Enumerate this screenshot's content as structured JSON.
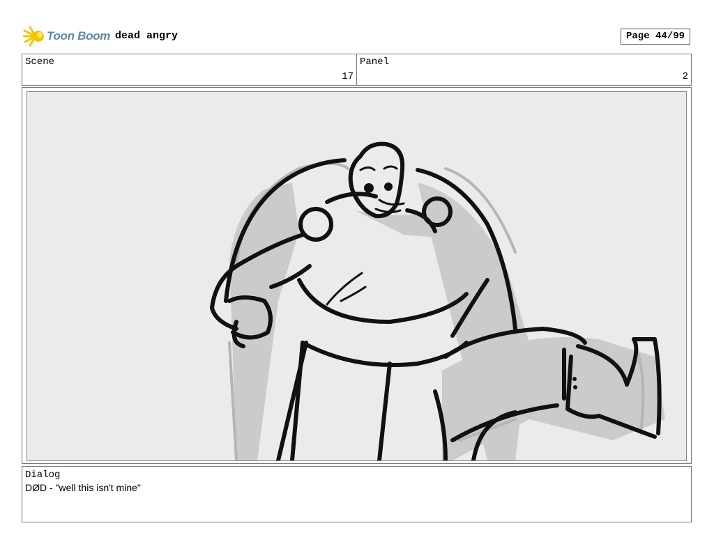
{
  "logo": {
    "text": "Toon Boom",
    "icon": "starburst-icon",
    "brand_color": "#5f88a8",
    "accent_color": "#f5c400"
  },
  "header": {
    "project_title": "dead angry",
    "page_label": "Page 44/99"
  },
  "scene": {
    "label": "Scene",
    "value": "17"
  },
  "panel": {
    "label": "Panel",
    "value": "2"
  },
  "frame": {
    "content": "storyboard-sketch"
  },
  "dialog": {
    "label": "Dialog",
    "text": "DØD - \"well this isn't mine\""
  }
}
